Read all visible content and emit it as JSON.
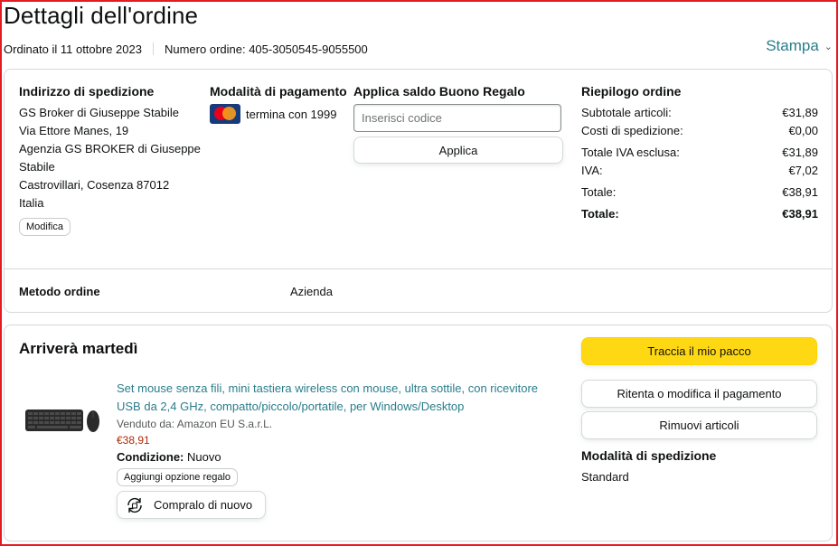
{
  "page": {
    "title": "Dettagli dell'ordine",
    "ordered_on": "Ordinato il 11 ottobre 2023",
    "order_number": "Numero ordine: 405-3050545-9055500",
    "print_label": "Stampa"
  },
  "address": {
    "heading": "Indirizzo di spedizione",
    "lines": [
      "GS Broker di Giuseppe Stabile",
      "Via Ettore Manes, 19",
      "Agenzia GS BROKER di Giuseppe",
      "Stabile",
      "Castrovillari, Cosenza 87012",
      "Italia"
    ],
    "edit_label": "Modifica"
  },
  "payment": {
    "heading": "Modalità di pagamento",
    "card_text": "termina con 1999",
    "card_icon": "mastercard-icon"
  },
  "gift": {
    "heading": "Applica saldo Buono Regalo",
    "placeholder": "Inserisci codice",
    "apply_label": "Applica"
  },
  "summary": {
    "heading": "Riepilogo ordine",
    "rows": [
      {
        "label": "Subtotale articoli:",
        "value": "€31,89"
      },
      {
        "label": "Costi di spedizione:",
        "value": "€0,00"
      },
      {
        "label": "Totale IVA esclusa:",
        "value": "€31,89"
      },
      {
        "label": "IVA:",
        "value": "€7,02"
      },
      {
        "label": "Totale:",
        "value": "€38,91"
      },
      {
        "label": "Totale:",
        "value": "€38,91"
      }
    ]
  },
  "order_method": {
    "label": "Metodo ordine",
    "value": "Azienda"
  },
  "shipment": {
    "heading": "Arriverà martedì",
    "product": {
      "title": "Set mouse senza fili, mini tastiera wireless con mouse, ultra sottile, con ricevitore USB da 2,4 GHz, compatto/piccolo/portatile, per Windows/Desktop",
      "seller": "Venduto da: Amazon EU S.a.r.L.",
      "price": "€38,91",
      "condition_label": "Condizione:",
      "condition_value": "Nuovo",
      "gift_option_label": "Aggiungi opzione regalo",
      "buy_again_label": "Compralo di nuovo",
      "image_icon": "keyboard-mouse-image"
    },
    "actions": {
      "track": "Traccia il mio pacco",
      "retry_payment": "Ritenta o modifica il pagamento",
      "remove_items": "Rimuovi articoli"
    },
    "shipping_mode_heading": "Modalità di spedizione",
    "shipping_mode_value": "Standard"
  },
  "colors": {
    "link": "#2a7d8b",
    "price": "#b12704",
    "primary_button": "#ffd814",
    "frame": "#e31b23"
  }
}
